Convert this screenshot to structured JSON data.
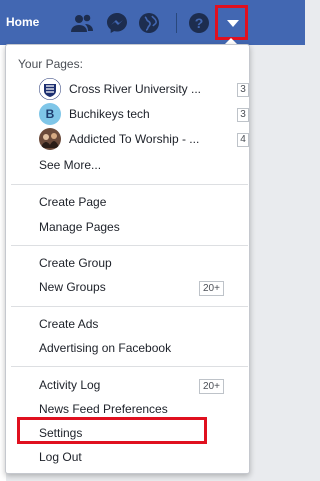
{
  "topbar": {
    "home_label": "Home"
  },
  "menu": {
    "your_pages_label": "Your Pages:",
    "pages": [
      {
        "name": "Cross River University ...",
        "count": "3",
        "avatar_letter": ""
      },
      {
        "name": "Buchikeys tech",
        "count": "3",
        "avatar_letter": "B"
      },
      {
        "name": "Addicted To Worship - ...",
        "count": "4",
        "avatar_letter": ""
      }
    ],
    "see_more": "See More...",
    "create_page": "Create Page",
    "manage_pages": "Manage Pages",
    "create_group": "Create Group",
    "new_groups": "New Groups",
    "new_groups_badge": "20+",
    "create_ads": "Create Ads",
    "advertising": "Advertising on Facebook",
    "activity_log": "Activity Log",
    "activity_log_badge": "20+",
    "news_feed_prefs": "News Feed Preferences",
    "settings": "Settings",
    "log_out": "Log Out"
  },
  "colors": {
    "brand": "#4267b2",
    "highlight": "#e0101f"
  }
}
